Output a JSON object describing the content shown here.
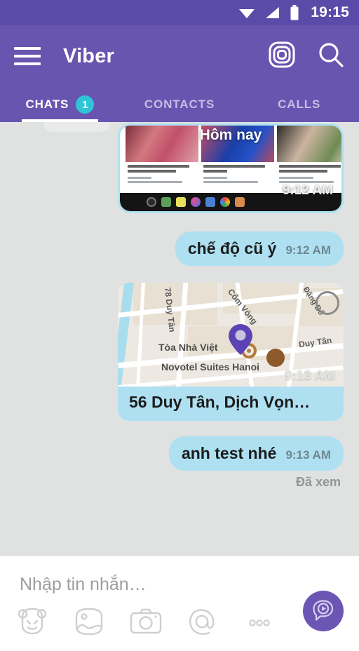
{
  "status_bar": {
    "time": "19:15",
    "icons": [
      "wifi-icon",
      "signal-icon",
      "battery-icon"
    ]
  },
  "header": {
    "menu_icon": "hamburger-menu-icon",
    "title": "Viber",
    "actions": [
      {
        "icon": "viber-camera-icon",
        "name": "discover-button"
      },
      {
        "icon": "search-icon",
        "name": "search-button"
      }
    ],
    "tabs": [
      {
        "label": "CHATS",
        "badge": "1",
        "active": true
      },
      {
        "label": "CONTACTS",
        "badge": "",
        "active": false
      },
      {
        "label": "CALLS",
        "badge": "",
        "active": false
      }
    ]
  },
  "chat": {
    "messages": [
      {
        "type": "image",
        "overlay_label": "Hôm nay",
        "time": "9:12 AM",
        "direction": "outgoing"
      },
      {
        "type": "text",
        "text": "chế độ cũ ý",
        "time": "9:12 AM",
        "direction": "outgoing"
      },
      {
        "type": "location",
        "address": "56 Duy Tân, Dịch Vọn…",
        "time": "9:13 AM",
        "direction": "outgoing",
        "map_labels": [
          "78 Duy Tân",
          "Cốm Vòng",
          "Tòa Nhà Việt",
          "Novotel Suites Hanoi",
          "Duy Tân",
          "Đặng Bổ"
        ]
      },
      {
        "type": "text",
        "text": "anh test nhé",
        "time": "9:13 AM",
        "direction": "outgoing"
      }
    ],
    "read_receipt": "Đã xem"
  },
  "composer": {
    "placeholder": "Nhập tin nhắn…",
    "value": "",
    "tools": [
      {
        "name": "sticker-icon",
        "label": "sticker"
      },
      {
        "name": "gallery-icon",
        "label": "gallery"
      },
      {
        "name": "camera-icon",
        "label": "camera"
      },
      {
        "name": "mention-icon",
        "label": "mention"
      },
      {
        "name": "more-options-icon",
        "label": "more"
      }
    ],
    "send_button_icon": "viber-send-icon"
  },
  "colors": {
    "status_bar": "#5B4BA8",
    "header": "#6755B0",
    "accent_badge": "#2EC5D8",
    "bubble_outgoing": "#AEE0F2",
    "chat_background": "#DFE2E1",
    "send_button": "#6C56B4",
    "pin": "#5B43B5"
  }
}
